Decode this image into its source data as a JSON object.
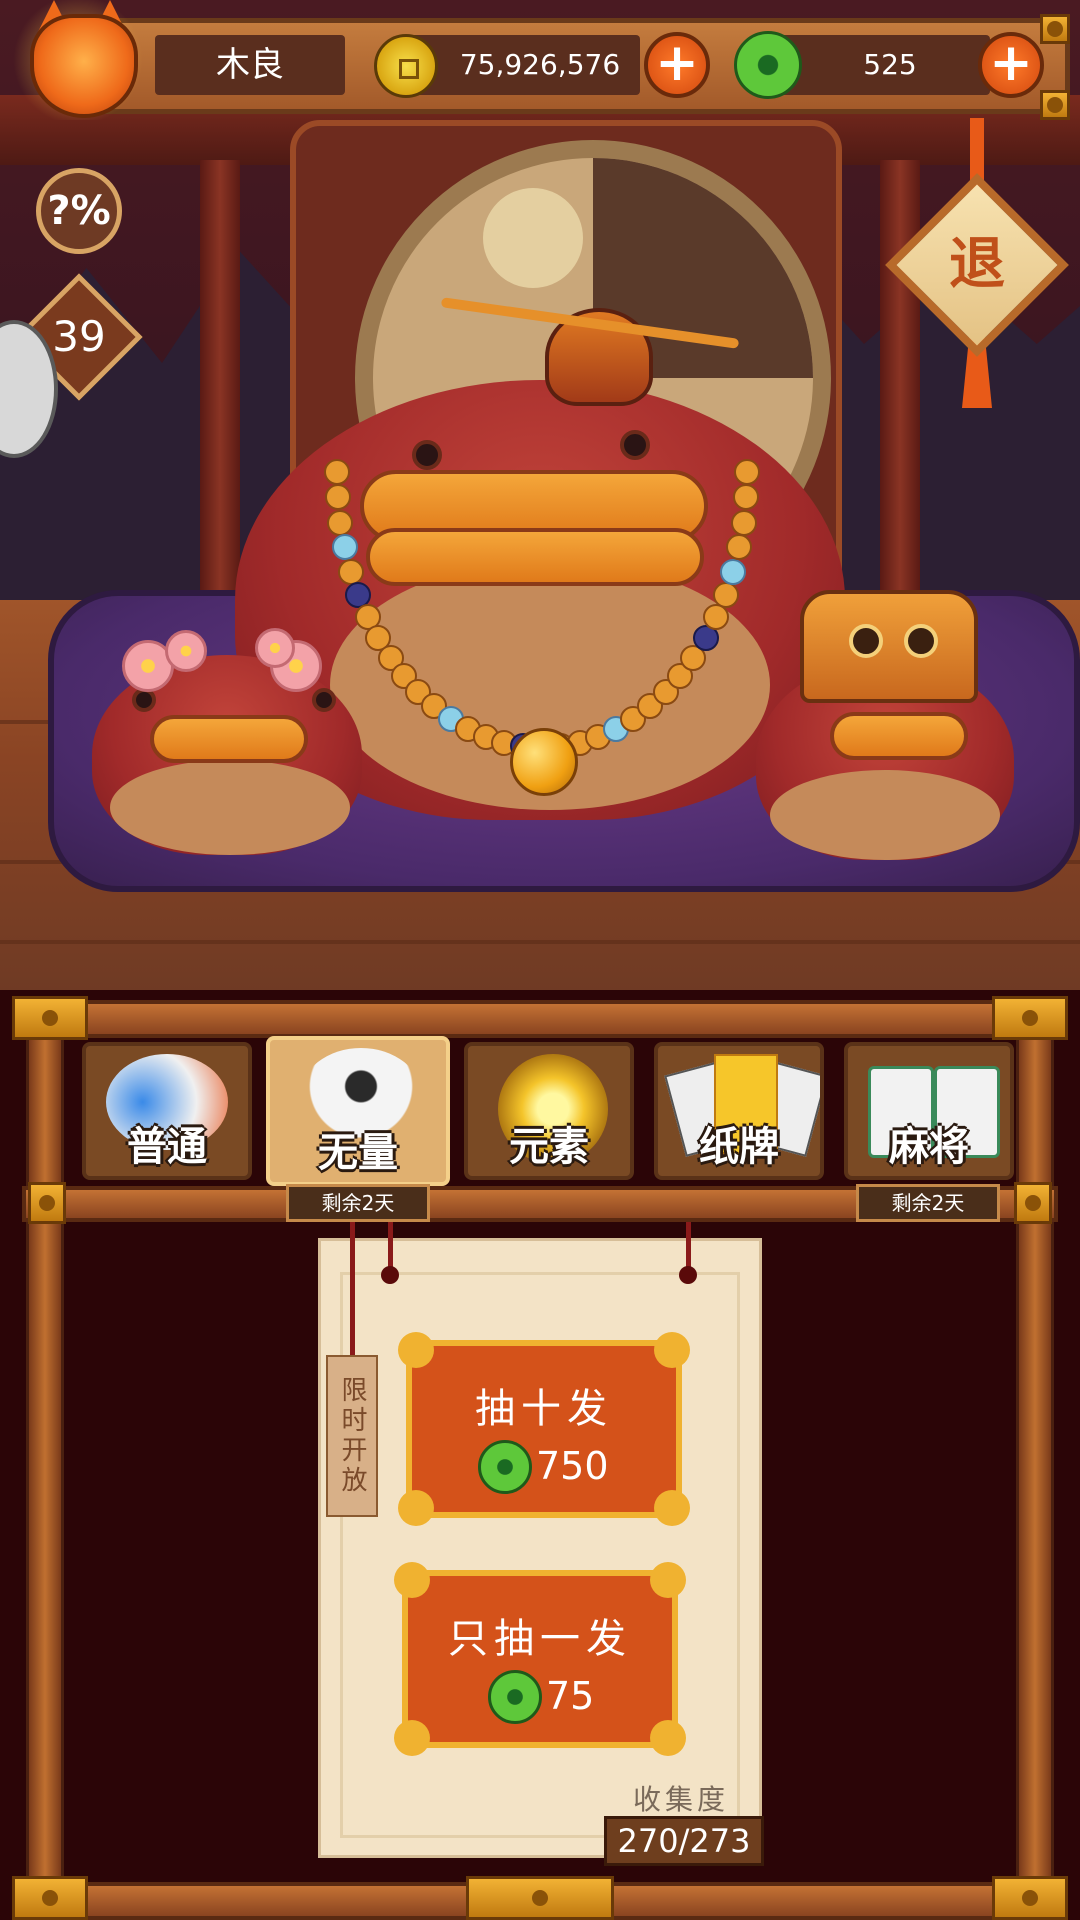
{
  "player": {
    "name": "木良",
    "level": "39",
    "coins": "75,926,576",
    "jade": "525"
  },
  "side": {
    "probability_label": "?%",
    "exit_label": "退"
  },
  "tabs": [
    {
      "label": "普通",
      "remaining": ""
    },
    {
      "label": "无量",
      "remaining": "剩余2天"
    },
    {
      "label": "元素",
      "remaining": ""
    },
    {
      "label": "纸牌",
      "remaining": ""
    },
    {
      "label": "麻将",
      "remaining": "剩余2天"
    }
  ],
  "active_tab": "无量",
  "limited_tag": "限时开放",
  "draw_ten": {
    "label": "抽十发",
    "cost": "750"
  },
  "draw_one": {
    "label": "只抽一发",
    "cost": "75"
  },
  "collection": {
    "label": "收集度",
    "value": "270/273"
  },
  "colors": {
    "button_orange": "#d4521a",
    "gold_border": "#f0b230",
    "jade_green": "#5ec83a",
    "coin_gold": "#d9a612"
  }
}
